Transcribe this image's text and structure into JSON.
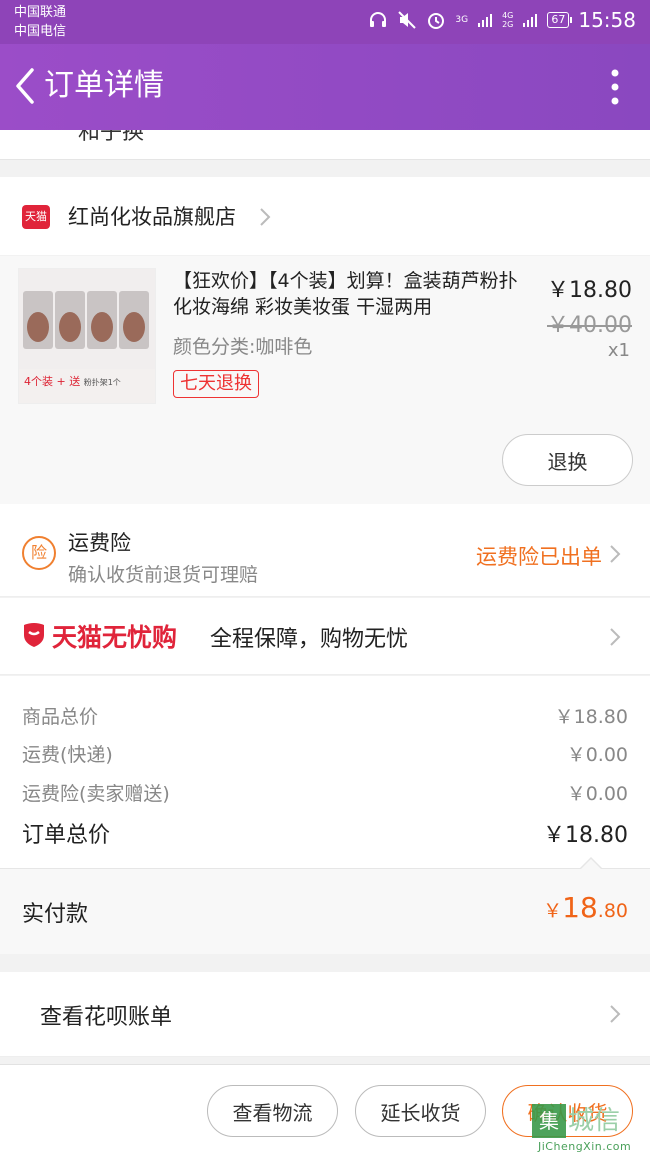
{
  "status_bar": {
    "carrier_1": "中国联通",
    "carrier_2": "中国电信",
    "network_1": "3G",
    "network_2": "4G",
    "network_3": "2G",
    "battery": "67",
    "time": "15:58"
  },
  "header": {
    "title": "订单详情",
    "accent_color": "#8e44b8"
  },
  "partial_text": "和子换",
  "shop": {
    "badge": "天猫",
    "name": "红尚化妆品旗舰店"
  },
  "item": {
    "title": "【狂欢价】【4个装】划算！盒装葫芦粉扑 化妆海绵 彩妆美妆蛋 干湿两用",
    "variant": "颜色分类:咖啡色",
    "tag": "七天退换",
    "price": "￥18.80",
    "original_price": "￥40.00",
    "quantity": "x1",
    "thumb_caption_main": "4个装 + 送",
    "thumb_caption_small": "粉扑架1个",
    "action_button": "退换"
  },
  "freight_insurance": {
    "icon_char": "险",
    "title": "运费险",
    "subtitle": "确认收货前退货可理赔",
    "status": "运费险已出单"
  },
  "worry_free": {
    "brand": "天猫无忧购",
    "description": "全程保障，购物无忧"
  },
  "costs": [
    {
      "label": "商品总价",
      "value": "￥18.80"
    },
    {
      "label": "运费(快递)",
      "value": "￥0.00"
    },
    {
      "label": "运费险(卖家赠送)",
      "value": "￥0.00"
    }
  ],
  "order_total": {
    "label": "订单总价",
    "value": "￥18.80"
  },
  "paid": {
    "label": "实付款",
    "yen": "￥",
    "integer": "18",
    "decimal": ".80",
    "color": "#f06418"
  },
  "bill": {
    "label": "查看花呗账单"
  },
  "bottom_actions": [
    "查看物流",
    "延长收货",
    "确认收货"
  ],
  "watermark": {
    "box_char": "集",
    "chars": "城信",
    "url": "JiChengXin.com"
  }
}
